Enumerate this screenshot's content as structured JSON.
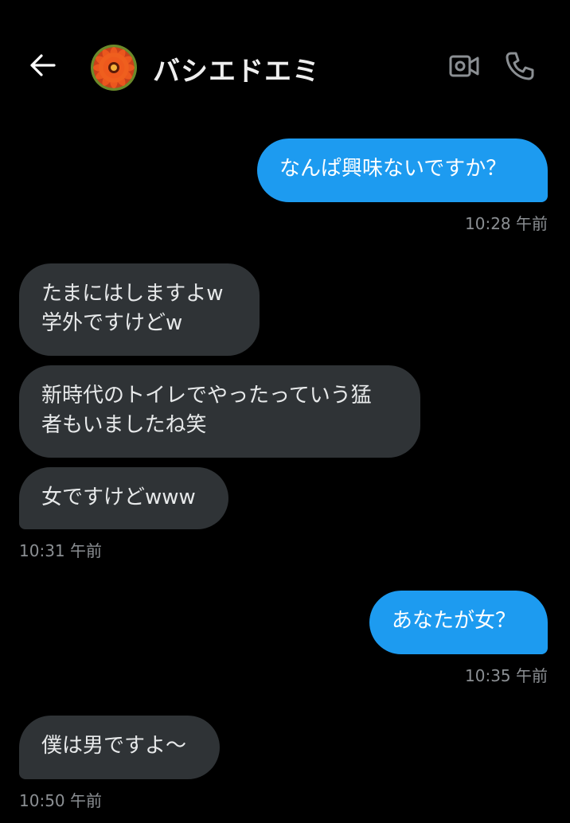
{
  "header": {
    "contact_name": "バシエドエミ"
  },
  "messages": [
    {
      "side": "sent",
      "text": "なんぱ興味ないですか？"
    },
    {
      "side": "received",
      "text": "たまにはしますよw\n学外ですけどw"
    },
    {
      "side": "received",
      "text": "新時代のトイレでやったっていう猛\n者もいましたね笑"
    },
    {
      "side": "received",
      "text": "女ですけどwww"
    },
    {
      "side": "sent",
      "text": "あなたが女？"
    },
    {
      "side": "received",
      "text": "僕は男ですよ〜"
    }
  ],
  "timestamps": [
    "10:28 午前",
    "10:31 午前",
    "10:35 午前",
    "10:50 午前"
  ],
  "colors": {
    "background": "#000000",
    "sent_bubble": "#1d9bf0",
    "received_bubble": "#2f3336",
    "timestamp": "#8b8f93"
  },
  "icons": [
    "back-arrow-icon",
    "video-call-icon",
    "phone-icon"
  ]
}
